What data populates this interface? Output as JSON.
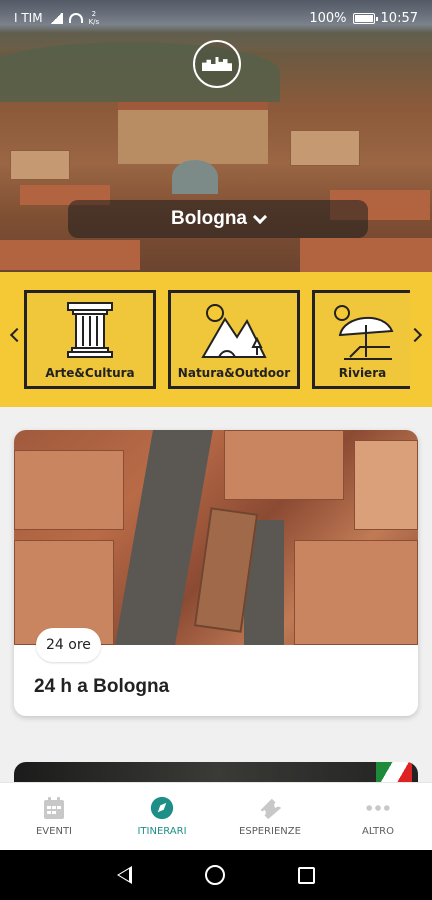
{
  "status_bar": {
    "carrier": "I TIM",
    "net_speed_top": "2",
    "net_speed_bottom": "K/s",
    "battery": "100%",
    "time": "10:57"
  },
  "header": {
    "logo_icon": "city-skyline-logo",
    "city": "Bologna"
  },
  "categories": [
    {
      "label": "Arte&Cultura",
      "icon": "column-icon"
    },
    {
      "label": "Natura&Outdoor",
      "icon": "mountains-icon"
    },
    {
      "label": "Riviera",
      "icon": "beach-umbrella-icon"
    }
  ],
  "itineraries": [
    {
      "duration": "24 ore",
      "title": "24 h a Bologna"
    }
  ],
  "bottom_nav": [
    {
      "label": "EVENTI",
      "icon": "calendar-icon"
    },
    {
      "label": "ITINERARI",
      "icon": "compass-icon"
    },
    {
      "label": "ESPERIENZE",
      "icon": "ticket-icon"
    },
    {
      "label": "ALTRO",
      "icon": "more-dots-icon"
    }
  ],
  "colors": {
    "accent_yellow": "#f5c935",
    "active_teal": "#1e8f87",
    "text_dark": "#222222"
  }
}
